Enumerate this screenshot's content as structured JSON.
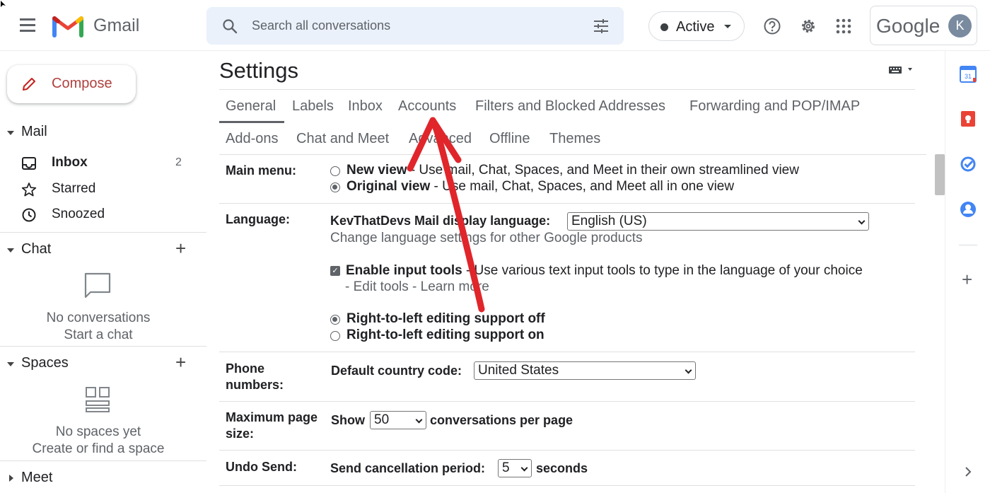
{
  "header": {
    "app_name": "Gmail",
    "search_placeholder": "Search all conversations",
    "status": "Active",
    "google_word": "Google",
    "avatar_initial": "K"
  },
  "sidebar": {
    "compose": "Compose",
    "mail_section": "Mail",
    "mail_items": [
      {
        "label": "Inbox",
        "count": "2",
        "icon": "inbox-icon"
      },
      {
        "label": "Starred",
        "count": "",
        "icon": "star-icon"
      },
      {
        "label": "Snoozed",
        "count": "",
        "icon": "clock-icon"
      }
    ],
    "chat_section": "Chat",
    "chat_empty": "No conversations",
    "chat_link": "Start a chat",
    "spaces_section": "Spaces",
    "spaces_empty": "No spaces yet",
    "spaces_link": "Create or find a space",
    "meet_section": "Meet"
  },
  "settings": {
    "title": "Settings",
    "tabs_row1": [
      "General",
      "Labels",
      "Inbox",
      "Accounts",
      "Filters and Blocked Addresses",
      "Forwarding and POP/IMAP"
    ],
    "tabs_row2": [
      "Add-ons",
      "Chat and Meet",
      "Advanced",
      "Offline",
      "Themes"
    ],
    "active_tab": "General",
    "main_menu": {
      "label": "Main menu:",
      "opt1_bold": "New view",
      "opt1_rest": " - Use mail, Chat, Spaces, and Meet in their own streamlined view",
      "opt2_bold": "Original view",
      "opt2_rest": " - Use mail, Chat, Spaces, and Meet all in one view",
      "selected": "Original view"
    },
    "language": {
      "label": "Language:",
      "display_label": "KevThatDevs Mail display language:",
      "display_value": "English (US)",
      "change_link": "Change language settings for other Google products",
      "input_tools_bold": "Enable input tools",
      "input_tools_rest": " - Use various text input tools to type in the language of your choice",
      "input_tools_checked": true,
      "edit_tools": "Edit tools",
      "learn_more": "Learn more",
      "rtl_off": "Right-to-left editing support off",
      "rtl_on": "Right-to-left editing support on",
      "rtl_selected": "off"
    },
    "phone": {
      "label_line1": "Phone",
      "label_line2": "numbers:",
      "country_label": "Default country code:",
      "country_value": "United States"
    },
    "page_size": {
      "label_line1": "Maximum page",
      "label_line2": "size:",
      "show": "Show",
      "value": "50",
      "suffix": "conversations per page"
    },
    "undo": {
      "label": "Undo Send:",
      "period_label": "Send cancellation period:",
      "value": "5",
      "suffix": "seconds"
    }
  },
  "right_rail": {
    "calendar_date": "31",
    "icons": [
      "calendar-icon",
      "keep-icon",
      "tasks-icon",
      "contacts-icon",
      "add-icon",
      "expand-icon"
    ]
  },
  "colors": {
    "annotation_arrow": "#e0262b",
    "compose_text": "#b0413e",
    "search_bg": "#eaf1fb"
  }
}
